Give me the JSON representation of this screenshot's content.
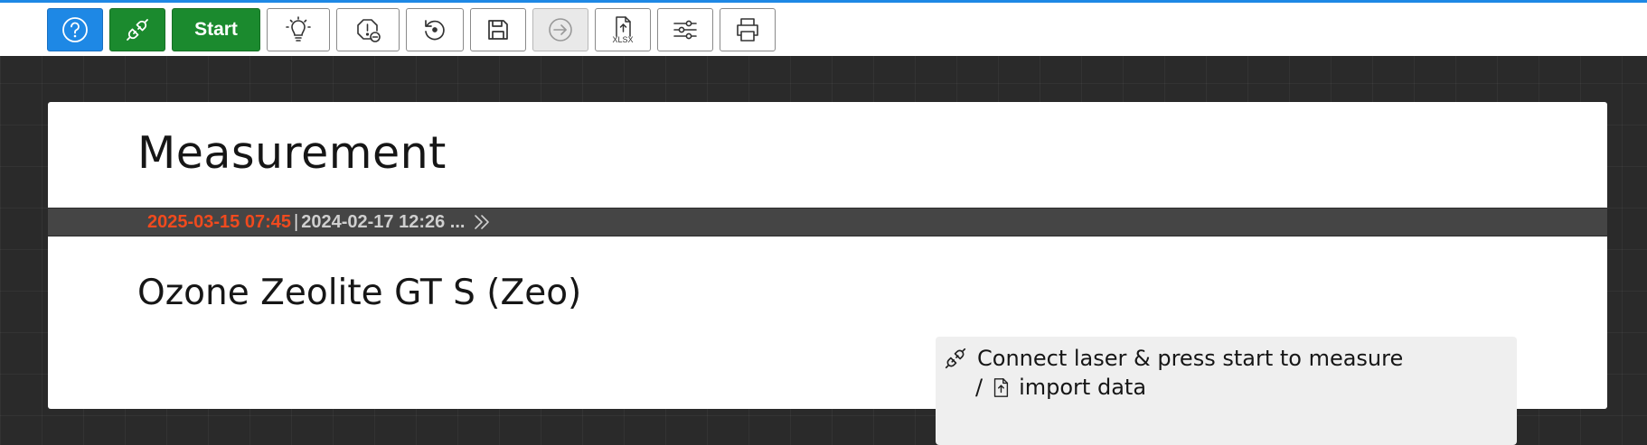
{
  "toolbar": {
    "buttons": [
      {
        "id": "help",
        "icon": "help-circle-icon"
      },
      {
        "id": "connect",
        "icon": "plug-icon"
      },
      {
        "id": "start",
        "label": "Start"
      },
      {
        "id": "bulb",
        "icon": "lightbulb-icon"
      },
      {
        "id": "warning",
        "icon": "alert-minus-icon"
      },
      {
        "id": "reset",
        "icon": "reset-icon"
      },
      {
        "id": "save",
        "icon": "save-icon"
      },
      {
        "id": "next",
        "icon": "arrow-right-circle-icon",
        "disabled": true
      },
      {
        "id": "export_xlsx",
        "icon": "file-upload-icon",
        "label": "XLSX"
      },
      {
        "id": "settings",
        "icon": "sliders-icon"
      },
      {
        "id": "print",
        "icon": "printer-icon"
      }
    ],
    "start_label": "Start",
    "xlsx_label": "XLSX"
  },
  "page": {
    "title": "Measurement"
  },
  "history": {
    "current": "2025-03-15 07:45",
    "separator": "|",
    "previous": "2024-02-17 12:26 ..."
  },
  "product": {
    "name": "Ozone Zeolite GT S (Zeo)"
  },
  "info": {
    "line1": "Connect laser & press start to measure",
    "line2_prefix": "/",
    "line2_text": "import data"
  },
  "colors": {
    "accent_blue": "#1e88e5",
    "start_green": "#1b8a2e",
    "date_current": "#f04a1e"
  }
}
